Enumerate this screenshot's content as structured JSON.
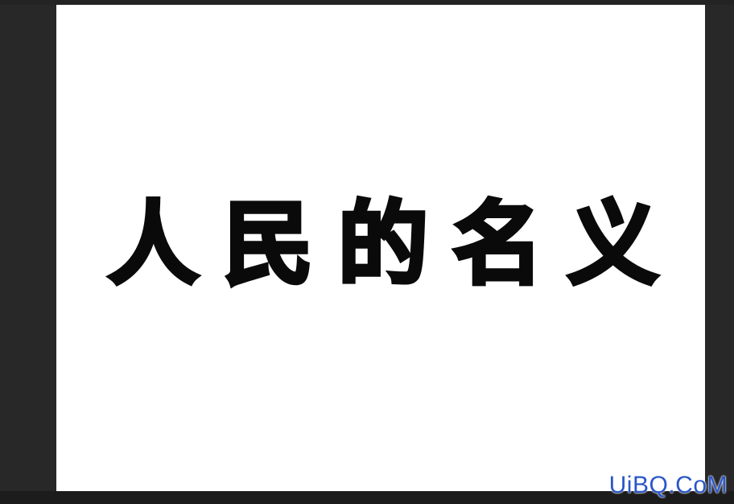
{
  "canvas": {
    "headline_chars": [
      "人",
      "民",
      "的",
      "名",
      "义"
    ]
  },
  "watermark": {
    "prefix": "UiBQ",
    "accent": "",
    "suffix": ".CoM",
    "text_color": "#2a56c8",
    "accent_color": "#6cbf3a"
  },
  "colors": {
    "workspace_bg": "#282828",
    "canvas_bg": "#ffffff",
    "text": "#0a0a0a"
  }
}
